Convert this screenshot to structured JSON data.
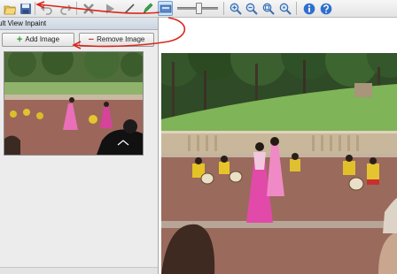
{
  "toolbar": {
    "icons": [
      "open-icon",
      "save-icon",
      "undo-icon",
      "redo-icon",
      "delete-icon",
      "play-icon",
      "line-icon",
      "pen-icon",
      "inpaint-icon",
      "zoom-in-icon",
      "zoom-out-icon",
      "zoom-fit-icon",
      "zoom-actual-icon",
      "info-icon",
      "help-icon"
    ],
    "accent": "#3a6fd8"
  },
  "panel": {
    "title": "ult View Inpaint",
    "add_label": "Add Image",
    "remove_label": "Remove Image",
    "add_color": "#2e9b2e",
    "remove_color": "#d23b2b"
  },
  "annotation": {
    "arrow_color": "#d9261c"
  }
}
